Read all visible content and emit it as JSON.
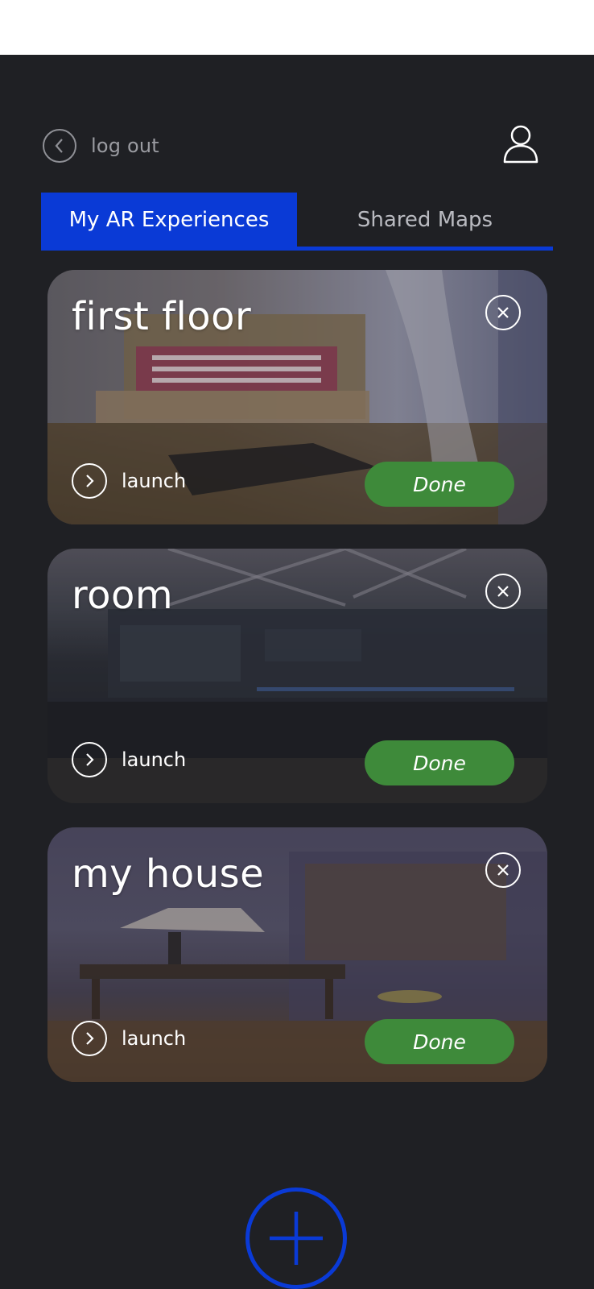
{
  "header": {
    "logout_label": "log out"
  },
  "tabs": [
    {
      "label": "My AR Experiences",
      "active": true
    },
    {
      "label": "Shared Maps",
      "active": false
    }
  ],
  "experiences": [
    {
      "title": "first floor",
      "launch_label": "launch",
      "status_label": "Done"
    },
    {
      "title": "room",
      "launch_label": "launch",
      "status_label": "Done"
    },
    {
      "title": "my house",
      "launch_label": "launch",
      "status_label": "Done"
    }
  ],
  "colors": {
    "background": "#1f2024",
    "accent": "#0a3ad6",
    "done": "#3e8a3a"
  },
  "icons": {
    "back": "chevron-left-icon",
    "profile": "user-icon",
    "close": "close-icon",
    "launch": "chevron-right-icon",
    "add": "plus-icon"
  }
}
